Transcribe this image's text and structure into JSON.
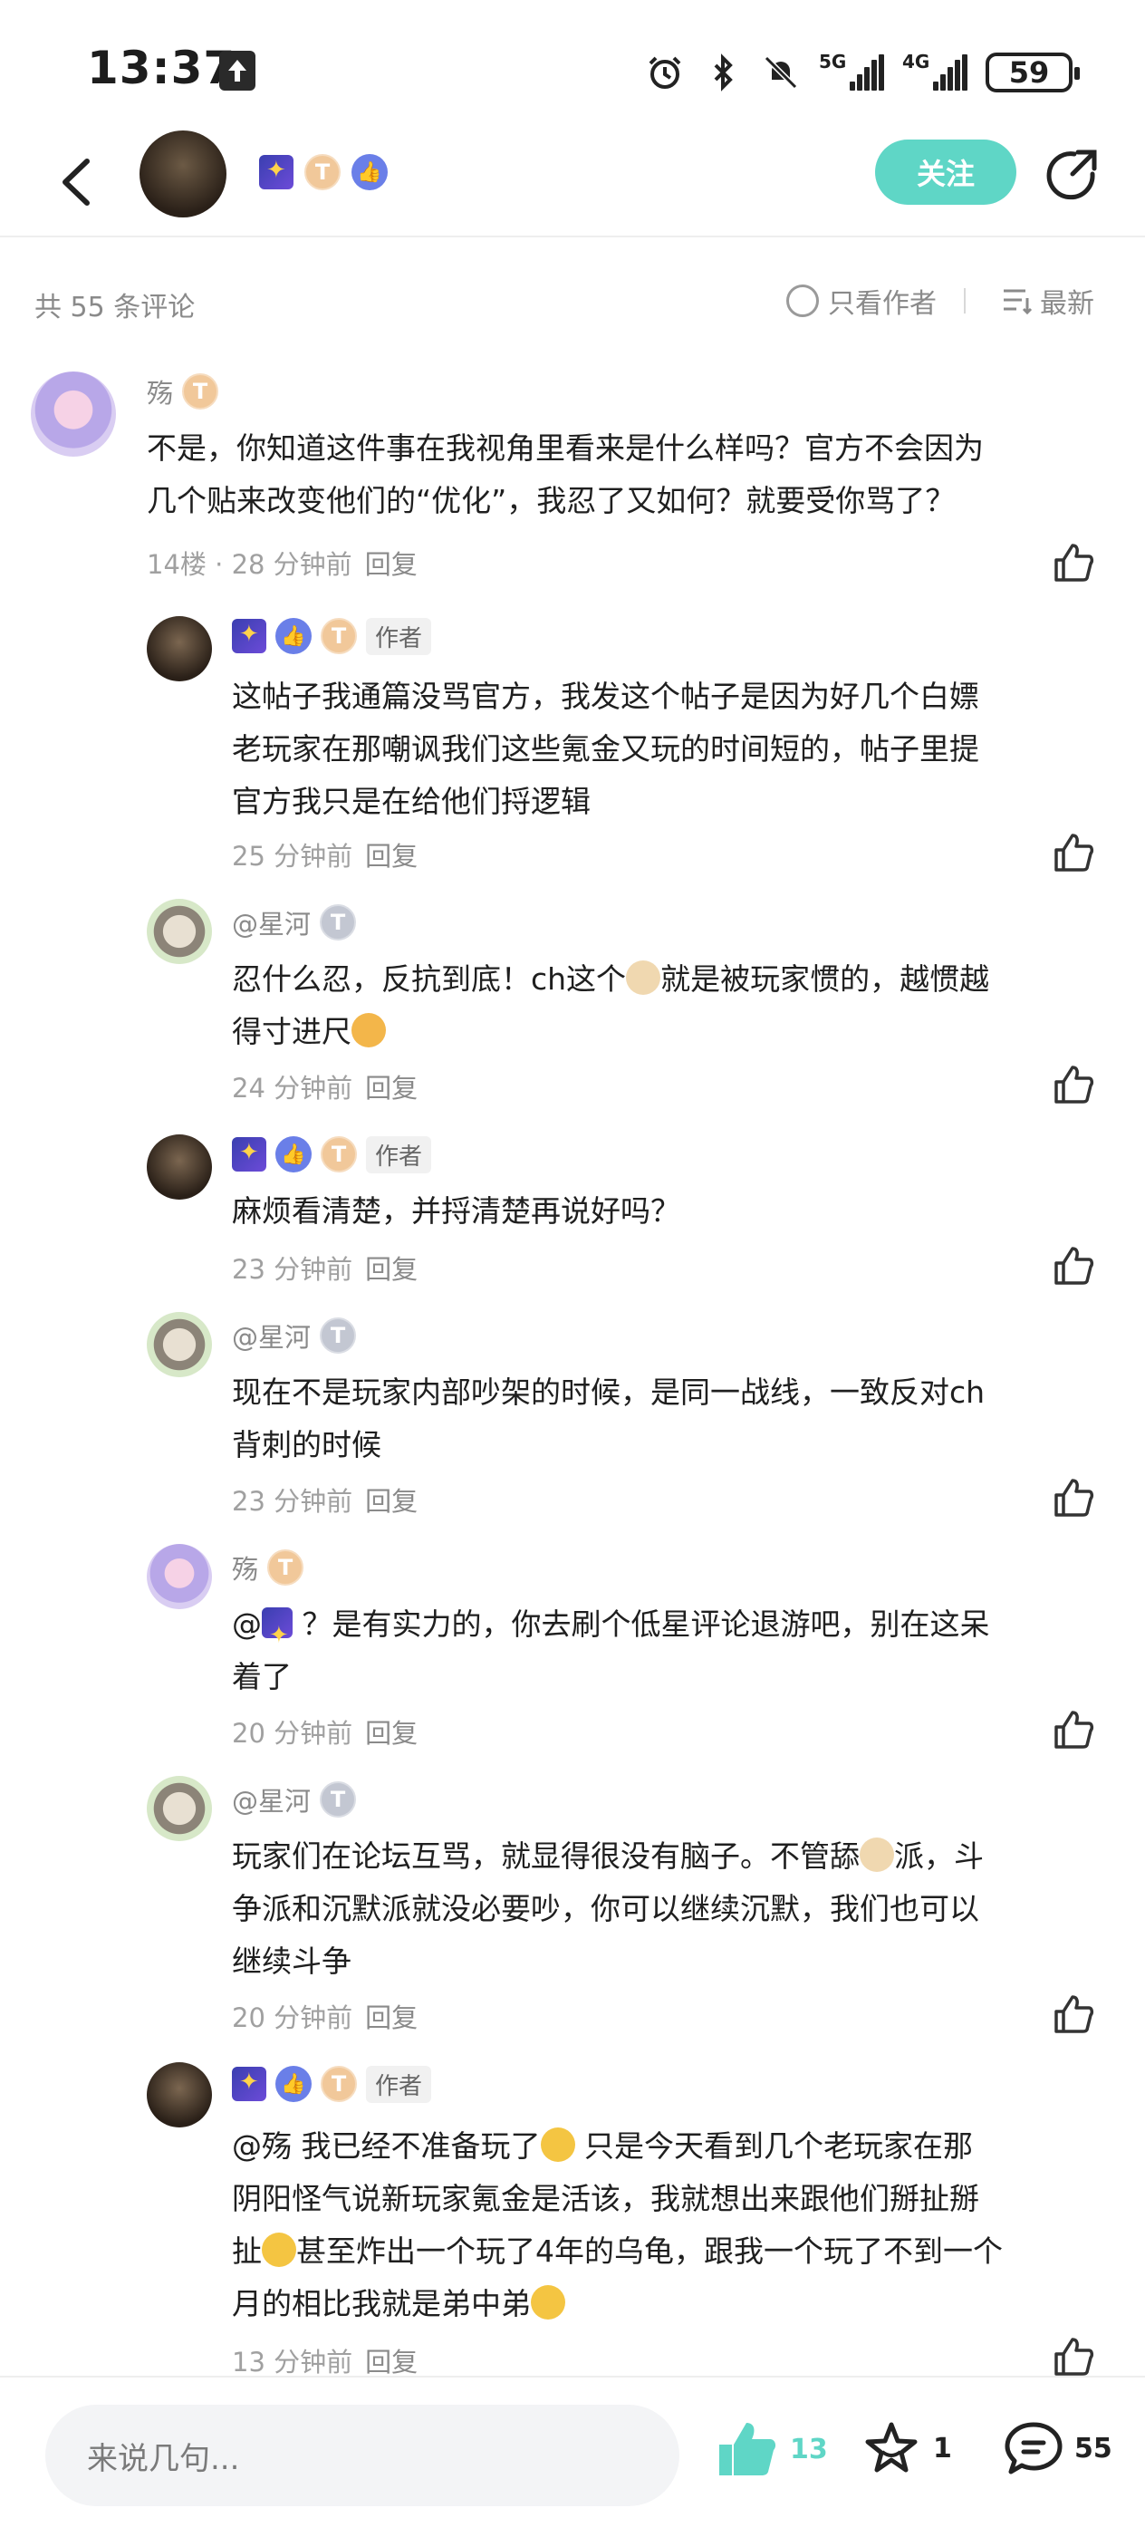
{
  "status": {
    "time": "13:37",
    "net1": "5G",
    "net2": "4G",
    "battery": "59"
  },
  "header": {
    "follow_label": "关注"
  },
  "subbar": {
    "count": "共 55 条评论",
    "author_only": "只看作者",
    "sort": "最新"
  },
  "comments": [
    {
      "name": "殇",
      "text_lines": [
        "不是，你知道这件事在我视角里看来是什么样吗？官方不会因为",
        "几个贴来改变他们的“优化”，我忍了又如何？就要受你骂了？"
      ],
      "floor": "14楼",
      "time": "28 分钟前",
      "reply": "回复"
    },
    {
      "name": "",
      "author_tag": "作者",
      "text_lines": [
        "这帖子我通篇没骂官方，我发这个帖子是因为好几个白嫖",
        "老玩家在那嘲讽我们这些氪金又玩的时间短的，帖子里提",
        "官方我只是在给他们捋逻辑"
      ],
      "time": "25 分钟前",
      "reply": "回复"
    },
    {
      "name": "@星河",
      "text_line1_a": "忍什么忍，反抗到底！ch这个",
      "text_line1_b": "就是被玩家惯的，越惯越",
      "text_line2": "得寸进尺",
      "time": "24 分钟前",
      "reply": "回复"
    },
    {
      "name": "",
      "author_tag": "作者",
      "text_lines": [
        "麻烦看清楚，并捋清楚再说好吗？"
      ],
      "time": "23 分钟前",
      "reply": "回复"
    },
    {
      "name": "@星河",
      "text_lines": [
        "现在不是玩家内部吵架的时候，是同一战线，一致反对ch",
        "背刺的时候"
      ],
      "time": "23 分钟前",
      "reply": "回复"
    },
    {
      "name": "殇",
      "text_line1_a": "@",
      "text_line1_b": " ？是有实力的，你去刷个低星评论退游吧，别在这呆",
      "text_line2": "着了",
      "time": "20 分钟前",
      "reply": "回复"
    },
    {
      "name": "@星河",
      "text_line1": "玩家们在论坛互骂，就显得很没有脑子。不管舔",
      "text_line1_b": "派，斗",
      "text_lines": [
        "争派和沉默派就没必要吵，你可以继续沉默，我们也可以",
        "继续斗争"
      ],
      "time": "20 分钟前",
      "reply": "回复"
    },
    {
      "name": "",
      "author_tag": "作者",
      "line1_a": "@殇  我已经不准备玩了",
      "line1_b": "  只是今天看到几个老玩家在那",
      "line2": "阴阳怪气说新玩家氪金是活该，我就想出来跟他们掰扯掰",
      "line3_a": "扯",
      "line3_b": "甚至炸出一个玩了4年的乌龟，跟我一个玩了不到一个",
      "line4_a": "月的相比我就是弟中弟",
      "time": "13 分钟前",
      "reply": "回复"
    }
  ],
  "bottom": {
    "input_placeholder": "来说几句...",
    "like_count": "13",
    "star_count": "1",
    "comment_count": "55"
  },
  "colors": {
    "accent": "#5fd6c6"
  }
}
